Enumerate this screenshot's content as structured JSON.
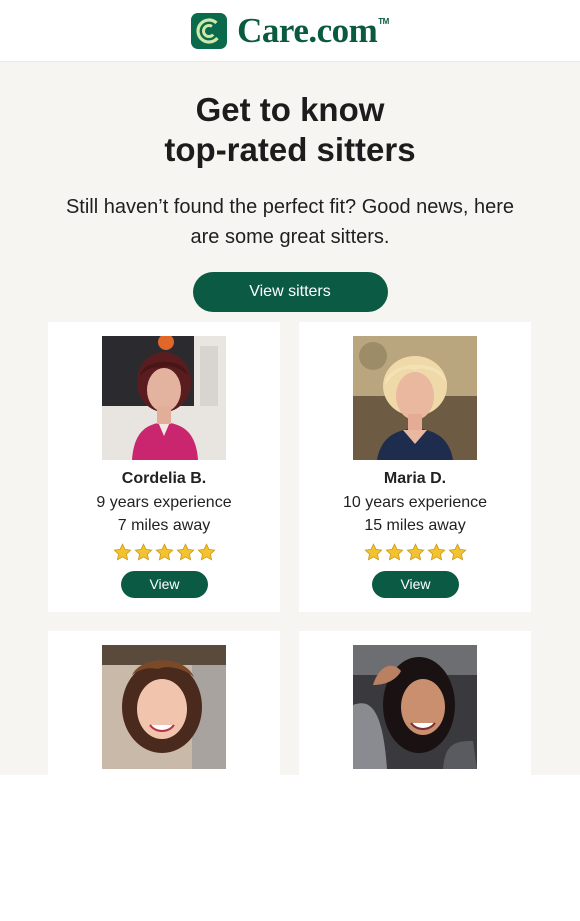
{
  "brand": {
    "name": "Care.com",
    "trademark": "TM",
    "color": "#0b6a4c",
    "icon": "care-logo-icon"
  },
  "hero": {
    "headline_line1": "Get to know",
    "headline_line2": "top-rated sitters",
    "subtext": "Still haven’t found the perfect fit? Good news, here are some great sitters.",
    "cta_label": "View sitters"
  },
  "colors": {
    "button": "#0b5a43",
    "background": "#f6f5f2",
    "card": "#ffffff",
    "star": "#f2c230"
  },
  "sitters": [
    {
      "name": "Cordelia B.",
      "experience": "9 years experience",
      "distance": "7 miles away",
      "rating": 5,
      "button_label": "View",
      "photo_icon": "sitter-photo"
    },
    {
      "name": "Maria D.",
      "experience": "10 years experience",
      "distance": "15 miles away",
      "rating": 5,
      "button_label": "View",
      "photo_icon": "sitter-photo"
    },
    {
      "photo_icon": "sitter-photo"
    },
    {
      "photo_icon": "sitter-photo"
    }
  ]
}
